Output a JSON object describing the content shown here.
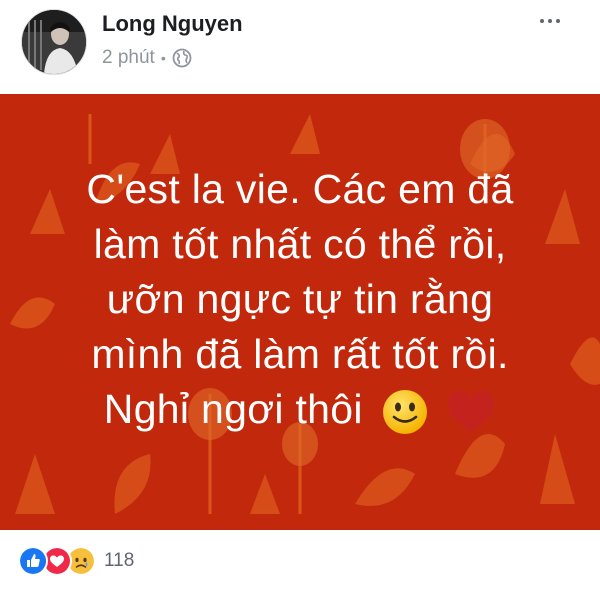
{
  "post": {
    "author": "Long Nguyen",
    "time": "2 phút",
    "separator": "•",
    "privacy_icon": "globe-icon",
    "more_icon": "more-horizontal-icon"
  },
  "banner": {
    "background_color": "#c2280c",
    "lines": [
      "C'est la vie. Các em đã",
      "làm tốt nhất có thể rồi,",
      "ưỡn ngực tự tin rằng",
      "mình đã làm rất tốt rồi.",
      "Nghỉ ngơi thôi"
    ],
    "emojis": [
      "slightly-smiling-face-icon",
      "red-heart-icon"
    ]
  },
  "reactions": {
    "icons": [
      "like-icon",
      "love-icon",
      "sad-icon"
    ],
    "count": "118"
  }
}
